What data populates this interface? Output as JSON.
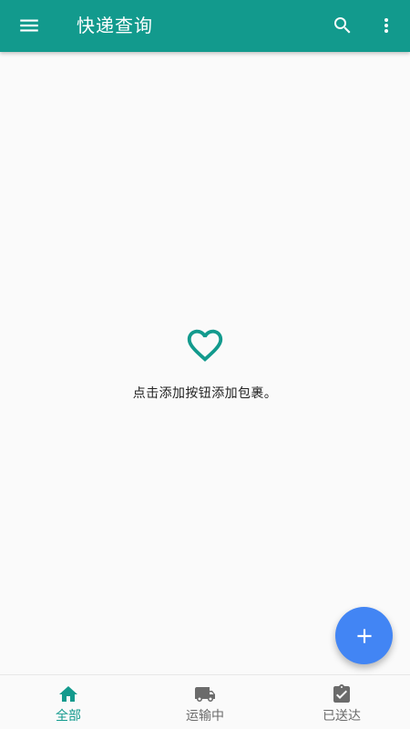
{
  "app": {
    "title": "快递查询",
    "accent": "#129a8d",
    "fab_color": "#4285f4"
  },
  "toolbar": {
    "menu_icon": "menu-icon",
    "search_icon": "search-icon",
    "more_icon": "more-vertical-icon"
  },
  "empty_state": {
    "icon": "heart-outline-icon",
    "message": "点击添加按钮添加包裹。"
  },
  "fab": {
    "icon": "plus-icon"
  },
  "bottom_nav": {
    "items": [
      {
        "label": "全部",
        "icon": "home-icon",
        "active": true
      },
      {
        "label": "运输中",
        "icon": "truck-icon",
        "active": false
      },
      {
        "label": "已送达",
        "icon": "clipboard-check-icon",
        "active": false
      }
    ]
  }
}
